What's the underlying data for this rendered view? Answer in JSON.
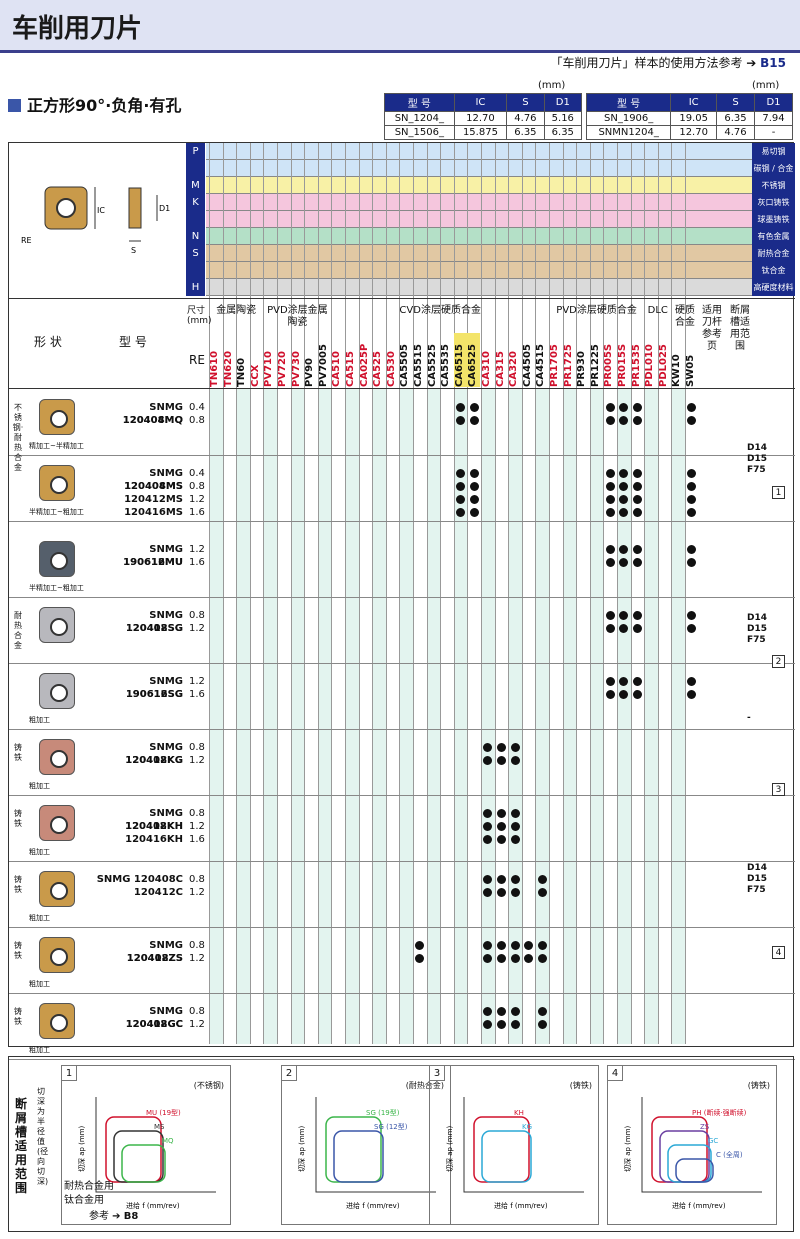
{
  "header": {
    "title": "车削用刀片",
    "reference": "「车削用刀片」样本的使用方法参考",
    "reference_page": "B15"
  },
  "subtitle": "正方形90°·负角·有孔",
  "unit": "(mm)",
  "dims_left": {
    "headers": [
      "型 号",
      "IC",
      "S",
      "D1"
    ],
    "rows": [
      [
        "SN_1204_",
        "12.70",
        "4.76",
        "5.16"
      ],
      [
        "SN_1506_",
        "15.875",
        "6.35",
        "6.35"
      ]
    ]
  },
  "dims_right": {
    "headers": [
      "型 号",
      "IC",
      "S",
      "D1"
    ],
    "rows": [
      [
        "SN_1906_",
        "19.05",
        "6.35",
        "7.94"
      ],
      [
        "SNMN1204_",
        "12.70",
        "4.76",
        "-"
      ]
    ]
  },
  "diagram": {
    "labels": [
      "IC",
      "D1",
      "S",
      "RE"
    ]
  },
  "materials": [
    {
      "letter": "P",
      "name": "易切钢",
      "color": "#cfe4f7"
    },
    {
      "letter": "",
      "name": "碳钢 / 合金钢",
      "color": "#cfe4f7"
    },
    {
      "letter": "M",
      "name": "不锈钢",
      "color": "#f8f1a6"
    },
    {
      "letter": "K",
      "name": "灰口铸铁",
      "color": "#f5c6dd"
    },
    {
      "letter": "",
      "name": "球墨铸铁",
      "color": "#f5c6dd"
    },
    {
      "letter": "N",
      "name": "有色金属",
      "color": "#b4e0c7"
    },
    {
      "letter": "S",
      "name": "耐热合金",
      "color": "#e1c8a3"
    },
    {
      "letter": "",
      "name": "钛合金",
      "color": "#e1c8a3"
    },
    {
      "letter": "H",
      "name": "高硬度材料",
      "color": "#dadada"
    }
  ],
  "table_header": {
    "shape": "形 状",
    "model": "型 号",
    "size": "尺寸(mm)",
    "re": "RE",
    "groups": [
      "金属陶瓷",
      "PVD涂层金属陶瓷",
      "CVD涂层硬质合金",
      "PVD涂层硬质合金",
      "DLC",
      "硬质合金",
      "适用刀杆参考页",
      "断屑槽适用范围"
    ]
  },
  "grades": [
    "TN610",
    "TN620",
    "TN60",
    "CCX",
    "PV710",
    "PV720",
    "PV730",
    "PV90",
    "PV7005",
    "CA510",
    "CA515",
    "CA025P",
    "CA525",
    "CA530",
    "CA5505",
    "CA5515",
    "CA5525",
    "CA5535",
    "CA6515",
    "CA6525",
    "CA310",
    "CA315",
    "CA320",
    "CA4505",
    "CA4515",
    "PR1705",
    "PR1725",
    "PR930",
    "PR1225",
    "PR005S",
    "PR015S",
    "PR1535",
    "PDL010",
    "PDL025",
    "KW10",
    "SW05"
  ],
  "rows": [
    {
      "models": [
        "SNMG 120404MQ",
        "120408MQ"
      ],
      "re": [
        "0.4",
        "0.8"
      ],
      "caption": "精加工~半精加工",
      "side": "不锈钢·耐热合金"
    },
    {
      "models": [
        "SNMG 120404MS",
        "120408MS",
        "120412MS",
        "120416MS"
      ],
      "re": [
        "0.4",
        "0.8",
        "1.2",
        "1.6"
      ],
      "caption": "半精加工~粗加工",
      "side": ""
    },
    {
      "models": [
        "SNMG 190612MU",
        "190616MU"
      ],
      "re": [
        "1.2",
        "1.6"
      ],
      "caption": "半精加工~粗加工",
      "side": ""
    },
    {
      "models": [
        "SNMG 120408SG",
        "120412SG"
      ],
      "re": [
        "0.8",
        "1.2"
      ],
      "caption": "",
      "side": "耐热合金"
    },
    {
      "models": [
        "SNMG 190612SG",
        "190616SG"
      ],
      "re": [
        "1.2",
        "1.6"
      ],
      "caption": "粗加工",
      "side": ""
    },
    {
      "models": [
        "SNMG 120408KG",
        "120412KG"
      ],
      "re": [
        "0.8",
        "1.2"
      ],
      "caption": "粗加工",
      "side": "铸铁"
    },
    {
      "models": [
        "SNMG 120408KH",
        "120412KH",
        "120416KH"
      ],
      "re": [
        "0.8",
        "1.2",
        "1.6"
      ],
      "caption": "粗加工",
      "side": "铸铁"
    },
    {
      "models": [
        "SNMG 120408C",
        "120412C"
      ],
      "re": [
        "0.8",
        "1.2"
      ],
      "caption": "粗加工",
      "side": "铸铁"
    },
    {
      "models": [
        "SNMG 120408ZS",
        "120412ZS"
      ],
      "re": [
        "0.8",
        "1.2"
      ],
      "caption": "粗加工",
      "side": "铸铁"
    },
    {
      "models": [
        "SNMG 120408GC",
        "120412GC"
      ],
      "re": [
        "0.8",
        "1.2"
      ],
      "caption": "粗加工",
      "side": "铸铁"
    }
  ],
  "ref_pages": [
    "D14\nD15\nF75",
    "D14\nD15\nF75",
    "-",
    "D14\nD15\nF75",
    "-",
    "D14\nD15\nF75"
  ],
  "chip_ranges": [
    "1",
    "2",
    "3",
    "4"
  ],
  "bottom": {
    "title": "断屑槽适用范围",
    "sub": "切深为半径值(径向切深)",
    "note_lines": [
      "耐热合金用",
      "钛合金用"
    ],
    "ref": "参考",
    "ref_page": "B8",
    "panels": [
      {
        "num": "1",
        "note": "(不锈钢)",
        "curves": [
          "MU (19型)",
          "MS",
          "MQ"
        ]
      },
      {
        "num": "2",
        "note": "(耐热合金)",
        "curves": [
          "SG (19型)",
          "SG (12型)"
        ]
      },
      {
        "num": "3",
        "note": "(铸铁)",
        "curves": [
          "KH",
          "KG"
        ]
      },
      {
        "num": "4",
        "note": "(铸铁)",
        "curves": [
          "PH (断续·强断续)",
          "ZS",
          "GC",
          "C (全周)"
        ]
      }
    ],
    "xlabel": "进给 f (mm/rev)",
    "ylabel": "切深 ap (mm)"
  }
}
